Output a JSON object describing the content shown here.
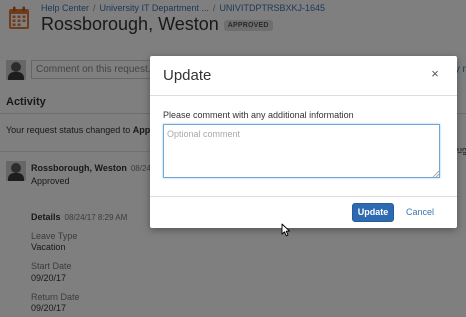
{
  "breadcrumb": {
    "items": [
      "Help Center",
      "University IT Department ...",
      "UNIVITDPTRSBXKJ-1645"
    ],
    "separator": "/"
  },
  "request": {
    "title": "Rossborough, Weston",
    "status_badge": "APPROVED"
  },
  "comment_input": {
    "placeholder": "Comment on this request..."
  },
  "right_link_fragment": "fy m",
  "activity": {
    "heading": "Activity",
    "status_prefix": "Your request status changed to ",
    "status_value": "Approv",
    "right_fragment": "oug"
  },
  "comment": {
    "author": "Rossborough, Weston",
    "date": "08/24/1",
    "text": "Approved"
  },
  "details": {
    "heading": "Details",
    "date": "08/24/17 8:29 AM",
    "fields": [
      {
        "label": "Leave Type",
        "value": "Vacation"
      },
      {
        "label": "Start Date",
        "value": "09/20/17"
      },
      {
        "label": "Return Date",
        "value": "09/20/17"
      }
    ]
  },
  "dialog": {
    "title": "Update",
    "close_glyph": "×",
    "prompt": "Please comment with any additional information",
    "textarea_placeholder": "Optional comment",
    "update_label": "Update",
    "cancel_label": "Cancel"
  },
  "colors": {
    "link": "#3b73af",
    "primary_button": "#2e6ab2",
    "calendar_icon": "#e07b39",
    "overlay": "rgba(0,0,0,0.5)"
  }
}
